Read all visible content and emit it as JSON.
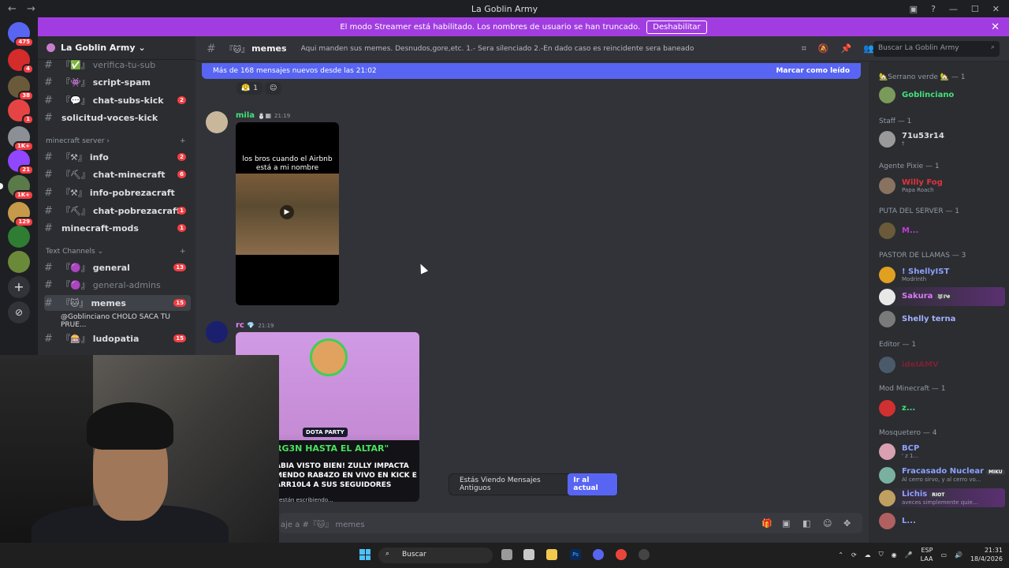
{
  "window": {
    "title": "La Goblin Army",
    "back": "←",
    "forward": "→"
  },
  "banner": {
    "text": "El modo Streamer está habilitado. Los nombres de usuario se han truncado.",
    "button": "Deshabilitar",
    "close": "✕"
  },
  "servers": [
    {
      "badge": "475"
    },
    {
      "badge": "4"
    },
    {
      "badge": "38"
    },
    {
      "badge": "1"
    },
    {
      "badge": "1K+"
    },
    {
      "badge": "21"
    },
    {
      "badge": "1K+"
    },
    {
      "badge": "129"
    },
    {
      "badge": ""
    },
    {
      "badge": ""
    }
  ],
  "server": {
    "name": "La Goblin Army",
    "chevron": "⌄"
  },
  "channels": [
    {
      "emoji": "『✅』",
      "name": "verifica-tu-sub",
      "count": "",
      "muted": true
    },
    {
      "emoji": "『👾』",
      "name": "script-spam",
      "count": ""
    },
    {
      "emoji": "『💬』",
      "name": "chat-subs-kick",
      "count": "2"
    },
    {
      "emoji": "",
      "name": "solicitud-voces-kick",
      "count": ""
    },
    {
      "emoji": "『⚒』",
      "name": "info",
      "count": "2"
    },
    {
      "emoji": "『⛏』",
      "name": "chat-minecraft",
      "count": "6"
    },
    {
      "emoji": "『⚒』",
      "name": "info-pobrezacraft",
      "count": ""
    },
    {
      "emoji": "『⛏』",
      "name": "chat-pobrezacraft",
      "count": "1"
    },
    {
      "emoji": "",
      "name": "minecraft-mods",
      "count": "1"
    },
    {
      "emoji": "『🟣』",
      "name": "general",
      "count": "13"
    },
    {
      "emoji": "『🟣』",
      "name": "general-admins",
      "count": "",
      "muted": true
    },
    {
      "emoji": "『🐱』",
      "name": "memes",
      "count": "15",
      "active": true
    },
    {
      "emoji": "",
      "name": "@Goblinciano CHOLO SACA TU PRUE...",
      "count": ""
    },
    {
      "emoji": "『🎰』",
      "name": "ludopatia",
      "count": "15"
    }
  ],
  "categories": {
    "minecraft": "minecraft server",
    "text": "Text Channels"
  },
  "header": {
    "channel_emoji": "『🐱』",
    "channel": "memes",
    "topic": "Aqui manden sus memes. Desnudos,gore,etc. 1.- Sera silenciado 2.-En dado caso es reincidente sera baneado",
    "search_placeholder": "Buscar La Goblin Army"
  },
  "newbar": {
    "text": "Más de 168 mensajes nuevos desde las 21:02",
    "mark": "Marcar como leído"
  },
  "reaction": {
    "emoji": "😤",
    "count": "1"
  },
  "messages": [
    {
      "author": "mila",
      "time": "21:19",
      "video_caption_1": "los bros cuando el Airbnb",
      "video_caption_2": "está a mi nombre"
    },
    {
      "author": "rc",
      "time": "21:19",
      "thumb_tag": "DOTA PARTY",
      "line1": "RG3N HASTA EL ALTAR\"",
      "line2": "ABIA VISTO BIEN! ZULLY IMPACTA MENDO RAB4ZO EN VIVO EN KICK E ARR10L4 A SUS SEGUIDORES"
    }
  ],
  "members": [
    {
      "cat": "🏡Serrano verde 🏡 — 1",
      "name": "Goblinciano",
      "color": "#43e27a",
      "sub": ""
    },
    {
      "cat": "Staff — 1",
      "name": "71u53r14",
      "color": "#dbdee1",
      "sub": "†"
    },
    {
      "cat": "Agente Pixie — 1",
      "name": "Willy Fog",
      "color": "#e0343c",
      "sub": "Papa Roach"
    },
    {
      "cat": "PUTA DEL SERVER — 1",
      "name": "M...",
      "color": "#c13bd6",
      "sub": ""
    },
    {
      "cat": "PASTOR DE LLAMAS — 3",
      "name": "! ShellyIST",
      "color": "#8ea1ff",
      "sub": "Modrinth"
    },
    {
      "cat": "",
      "name": "Sakura",
      "color": "#d87cf2",
      "sub": "",
      "tag": "🐺I༄"
    },
    {
      "cat": "",
      "name": "Shelly terna",
      "color": "#a4b1ff",
      "sub": ""
    },
    {
      "cat": "Editor — 1",
      "name": "ideIAMV",
      "color": "#7a2133",
      "sub": ""
    },
    {
      "cat": "Mod Minecraft — 1",
      "name": "z...",
      "color": "#43e27a",
      "sub": ""
    },
    {
      "cat": "Mosquetero — 4",
      "name": "BCP",
      "color": "#8ea1ff",
      "sub": "' z 1..."
    },
    {
      "cat": "",
      "name": "Fracasado Nuclear",
      "color": "#8ea1ff",
      "sub": "Al cerro sirvo, y al cerro vo...",
      "tag": "MIKU"
    },
    {
      "cat": "",
      "name": "Lichis",
      "color": "#8ea1ff",
      "sub": "aveces simplemente quie...",
      "tag": "RIOT"
    },
    {
      "cat": "",
      "name": "L...",
      "color": "#8ea1ff",
      "sub": ""
    }
  ],
  "scroll_hint": {
    "text": "Estás Viendo Mensajes Antiguos",
    "button": "Ir al actual"
  },
  "composer": {
    "placeholder": "aje a #『🐱』 memes",
    "typing": "están escribiendo..."
  },
  "taskbar": {
    "search": "Buscar",
    "lang1": "ESP",
    "lang2": "LAA",
    "time": "21:31",
    "date": "18/4/2026"
  }
}
